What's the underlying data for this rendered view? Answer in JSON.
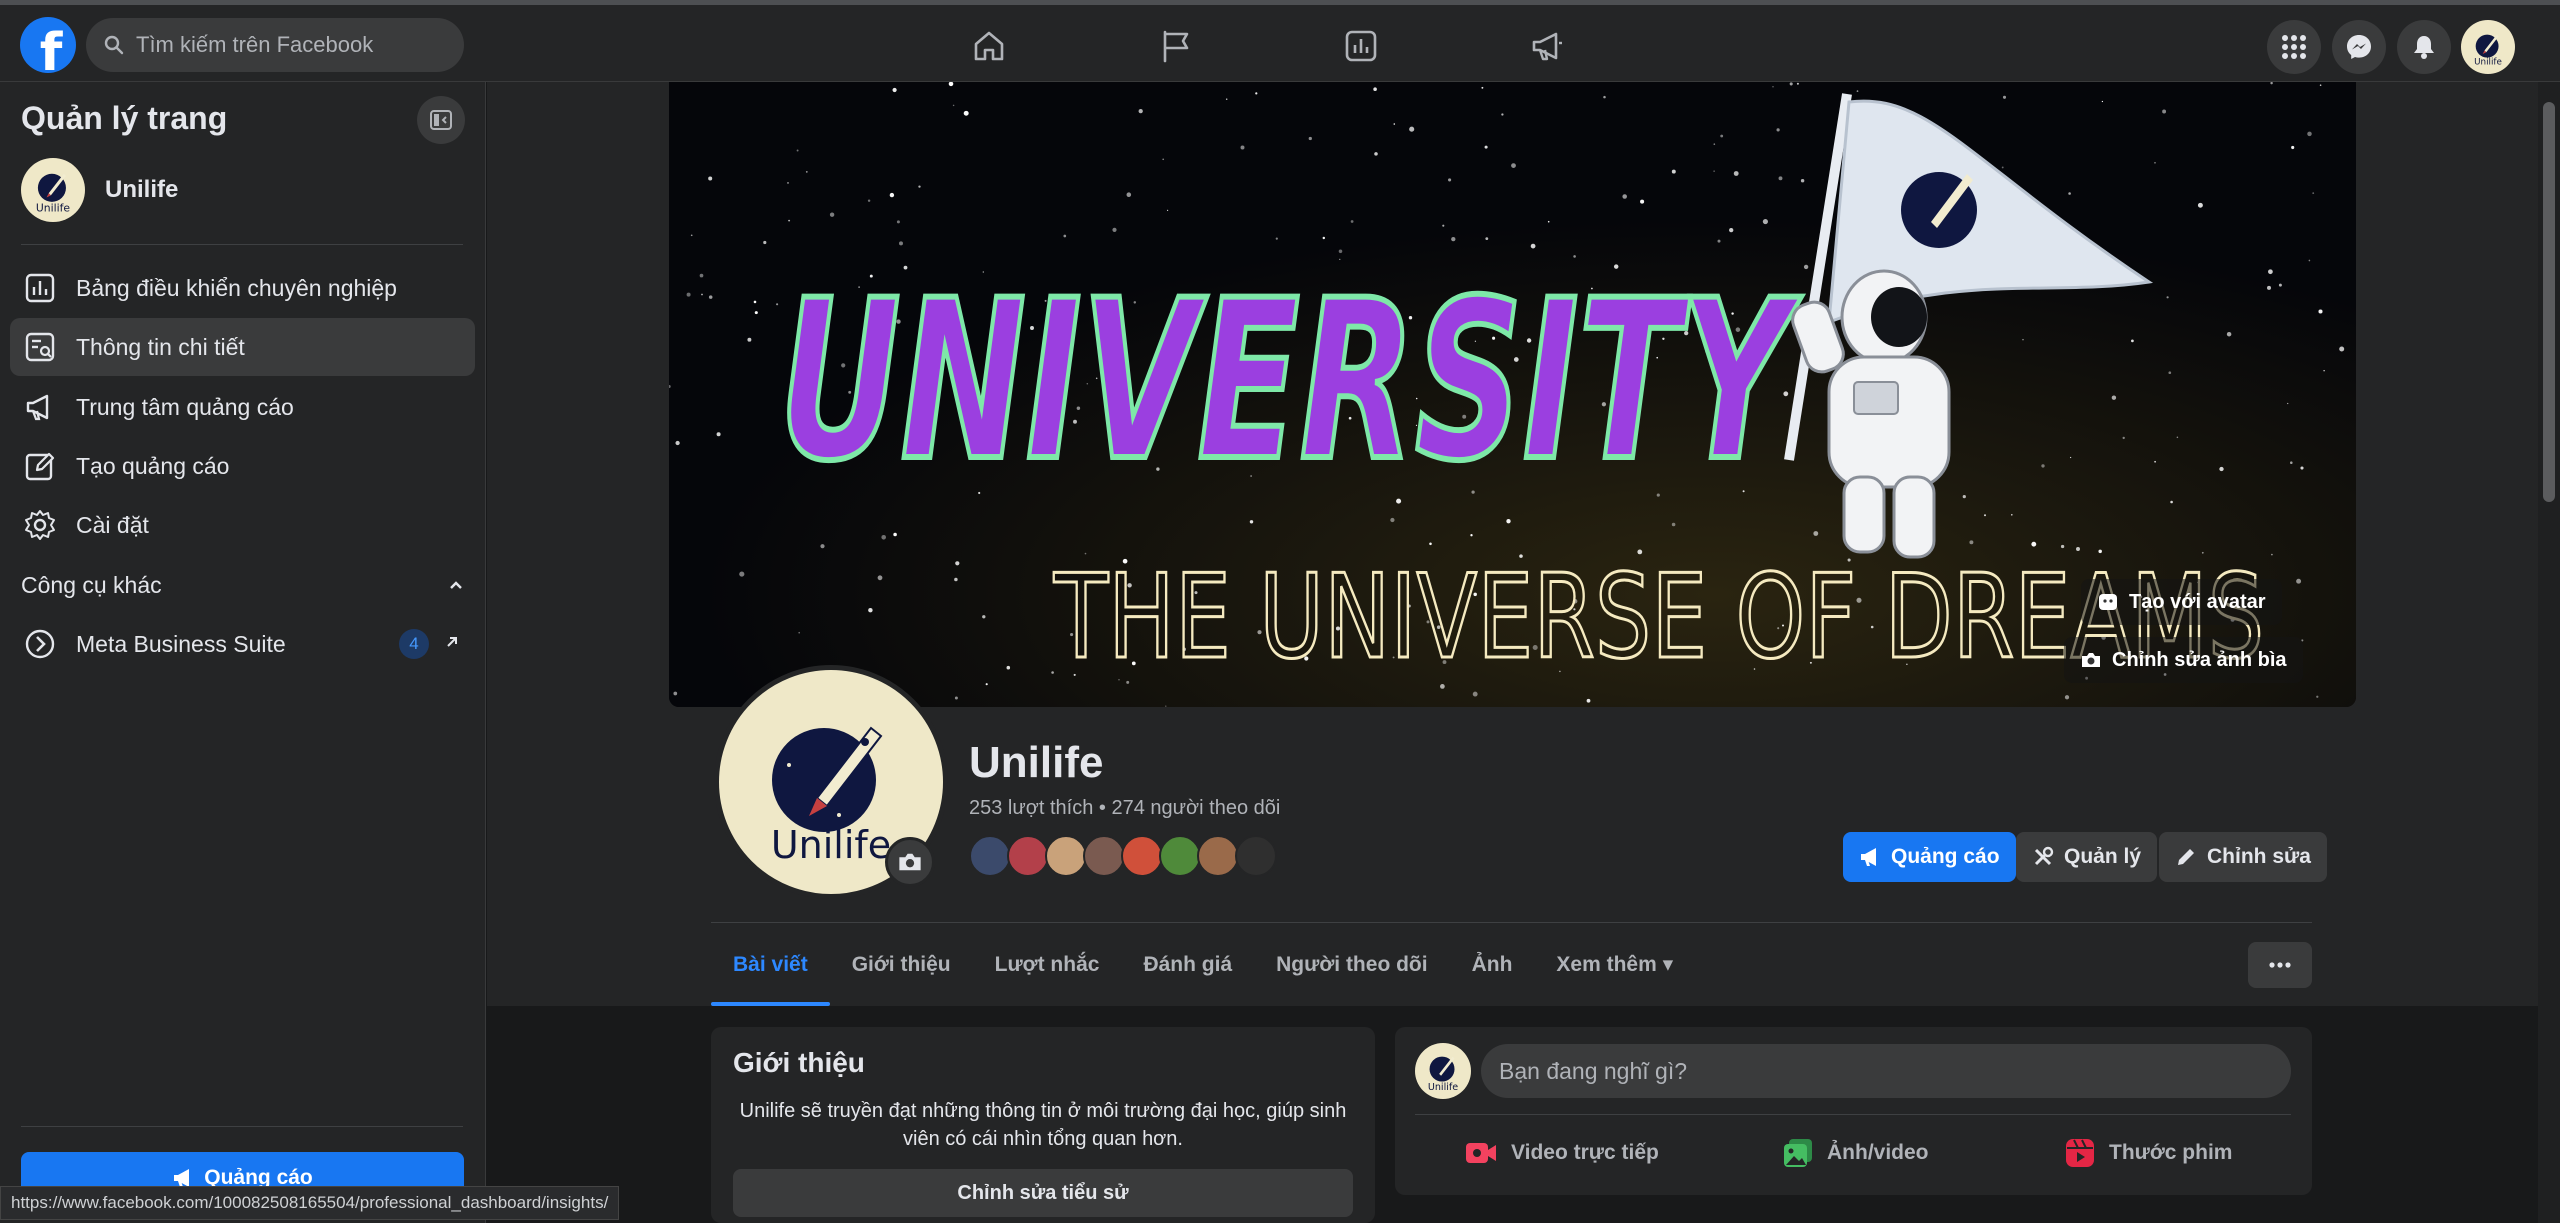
{
  "topbar": {
    "logo_letter": "f",
    "search_placeholder": "Tìm kiếm trên Facebook"
  },
  "sidebar": {
    "title": "Quản lý trang",
    "page_name": "Unilife",
    "items": [
      {
        "label": "Bảng điều khiển chuyên nghiệp",
        "icon": "dashboard-icon"
      },
      {
        "label": "Thông tin chi tiết",
        "icon": "insights-icon",
        "active": true
      },
      {
        "label": "Trung tâm quảng cáo",
        "icon": "megaphone-icon"
      },
      {
        "label": "Tạo quảng cáo",
        "icon": "edit-icon"
      },
      {
        "label": "Cài đặt",
        "icon": "gear-icon"
      }
    ],
    "other_tools": {
      "label": "Công cụ khác",
      "item_label": "Meta Business Suite",
      "badge": "4"
    },
    "ad_button": "Quảng cáo"
  },
  "status_url": "https://www.facebook.com/100082508165504/professional_dashboard/insights/",
  "cover": {
    "headline": "UNIVERSITY",
    "tagline": "THE UNIVERSE OF DREAMS",
    "avatar_button": "Tạo với avatar",
    "edit_button": "Chỉnh sửa ảnh bìa"
  },
  "profile": {
    "logo_text": "Unilife",
    "name": "Unilife",
    "stats": "253 lượt thích • 274 người theo dõi",
    "follower_colors": [
      "#3b4a6b",
      "#b3404a",
      "#c9a27a",
      "#7a5a50",
      "#d0503a",
      "#4f8a3a",
      "#9a6a4a",
      "#2f2f2f"
    ]
  },
  "actions": {
    "ads": "Quảng cáo",
    "manage": "Quản lý",
    "edit": "Chỉnh sửa"
  },
  "tabs": [
    {
      "label": "Bài viết",
      "active": true
    },
    {
      "label": "Giới thiệu"
    },
    {
      "label": "Lượt nhắc"
    },
    {
      "label": "Đánh giá"
    },
    {
      "label": "Người theo dõi"
    },
    {
      "label": "Ảnh"
    },
    {
      "label": "Xem thêm ▾"
    }
  ],
  "intro": {
    "title": "Giới thiệu",
    "text": "Unilife sẽ truyền đạt những thông tin ở môi trường đại học, giúp sinh viên có cái nhìn tổng quan hơn.",
    "button": "Chỉnh sửa tiểu sử"
  },
  "composer": {
    "placeholder": "Bạn đang nghĩ gì?",
    "live": "Video trực tiếp",
    "photo": "Ảnh/video",
    "reel": "Thước phim"
  },
  "colors": {
    "accent": "#1877f2",
    "bg": "#18191a",
    "surface": "#242526",
    "purple": "#9b3fe0",
    "mint": "#7ee8a8",
    "live_red": "#f3425f",
    "photo_green": "#45bd62",
    "reel_pink": "#e42645"
  }
}
